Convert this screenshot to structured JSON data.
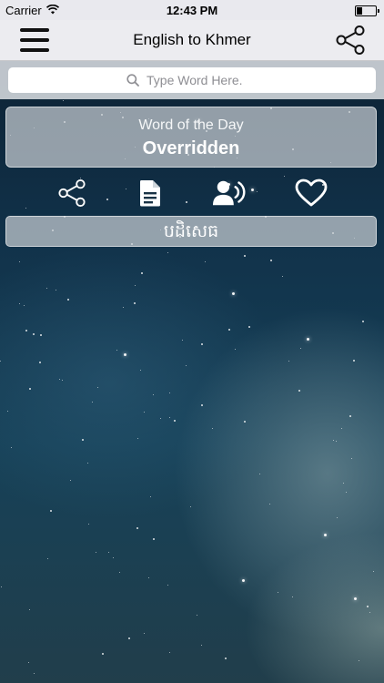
{
  "status_bar": {
    "carrier": "Carrier",
    "time": "12:43 PM",
    "battery_level_percent": 30
  },
  "nav_bar": {
    "title": "English to Khmer",
    "menu_icon": "hamburger-menu-icon",
    "share_icon": "share-icon"
  },
  "search": {
    "placeholder": "Type Word Here.",
    "value": ""
  },
  "word_of_day": {
    "label": "Word of the Day",
    "word": "Overridden"
  },
  "actions": [
    {
      "name": "share",
      "icon": "share-icon"
    },
    {
      "name": "details",
      "icon": "document-icon"
    },
    {
      "name": "speak",
      "icon": "speaker-voice-icon"
    },
    {
      "name": "favorite",
      "icon": "heart-icon"
    }
  ],
  "translation": {
    "text": "បដិសេធ"
  },
  "colors": {
    "nav_background": "#ececf0",
    "card_background": "#c8cdd2",
    "icon_color": "#ffffff"
  }
}
